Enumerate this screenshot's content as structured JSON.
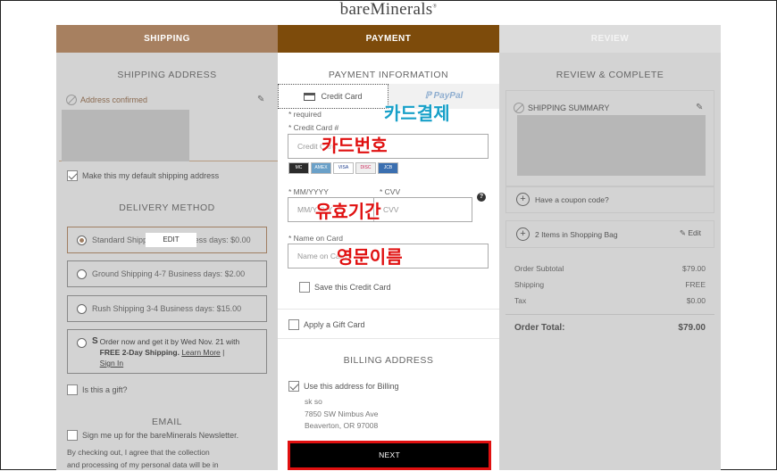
{
  "brand": "bareMinerals",
  "steps": [
    {
      "label": "SHIPPING"
    },
    {
      "label": "PAYMENT"
    },
    {
      "label": "REVIEW"
    }
  ],
  "shipping": {
    "title": "SHIPPING ADDRESS",
    "address_status": "Address confirmed",
    "default_label": "Make this my default shipping address",
    "delivery_title": "DELIVERY METHOD",
    "options": [
      {
        "label": "Standard Shipping 5-7 Business days: $0.00",
        "selected": true
      },
      {
        "label": "Ground Shipping 4-7 Business days: $2.00",
        "selected": false
      },
      {
        "label": "Rush Shipping 3-4 Business days: $15.00",
        "selected": false
      }
    ],
    "promo_line1": "Order now and get it by Wed Nov. 21 with",
    "promo_bold": "FREE 2-Day Shipping.",
    "promo_learn": "Learn More",
    "promo_sep": "|",
    "promo_signin": "Sign In",
    "edit_chip": "EDIT",
    "gift_label": "Is this a gift?",
    "email_title": "EMAIL",
    "newsletter_label": "Sign me up for the bareMinerals Newsletter.",
    "consent_line1": "By checking out, I agree that the collection",
    "consent_line2": "and processing of my personal data will be in"
  },
  "payment": {
    "title": "PAYMENT INFORMATION",
    "tab_cc": "Credit Card",
    "tab_paypal": "PayPal",
    "required": "* required",
    "cc_label": "* Credit Card #",
    "cc_placeholder": "Credit Card",
    "cards": [
      "MC",
      "AMEX",
      "VISA",
      "DISC",
      "JCB"
    ],
    "mm_label": "* MM/YYYY",
    "mm_placeholder": "MM/YYYY",
    "cvv_label": "* CVV",
    "cvv_placeholder": "CVV",
    "help": "?",
    "name_label": "* Name on Card",
    "name_placeholder": "Name on Card",
    "save_label": "Save this Credit Card",
    "gift_card_label": "Apply a Gift Card",
    "billing_title": "BILLING ADDRESS",
    "use_billing_label": "Use this address for Billing",
    "address_lines": [
      "sk so",
      "7850 SW Nimbus Ave",
      "Beaverton, OR 97008"
    ],
    "next_label": "NEXT"
  },
  "review": {
    "title": "REVIEW & COMPLETE",
    "summary_label": "SHIPPING SUMMARY",
    "coupon_label": "Have a coupon code?",
    "bag_label": "2 Items in Shopping Bag",
    "bag_edit": "Edit",
    "rows": [
      {
        "label": "Order Subtotal",
        "value": "$79.00"
      },
      {
        "label": "Shipping",
        "value": "FREE"
      },
      {
        "label": "Tax",
        "value": "$0.00"
      }
    ],
    "total_label": "Order Total:",
    "total_value": "$79.00"
  },
  "annotations": {
    "card_payment": "카드결제",
    "card_number": "카드번호",
    "expiry": "유효기간",
    "english_name": "영문이름"
  },
  "colors": {
    "tab_shipping": "#a78060",
    "tab_payment": "#7d4b0b",
    "annotation_blue": "#17a0c8",
    "annotation_red": "#e01010"
  }
}
